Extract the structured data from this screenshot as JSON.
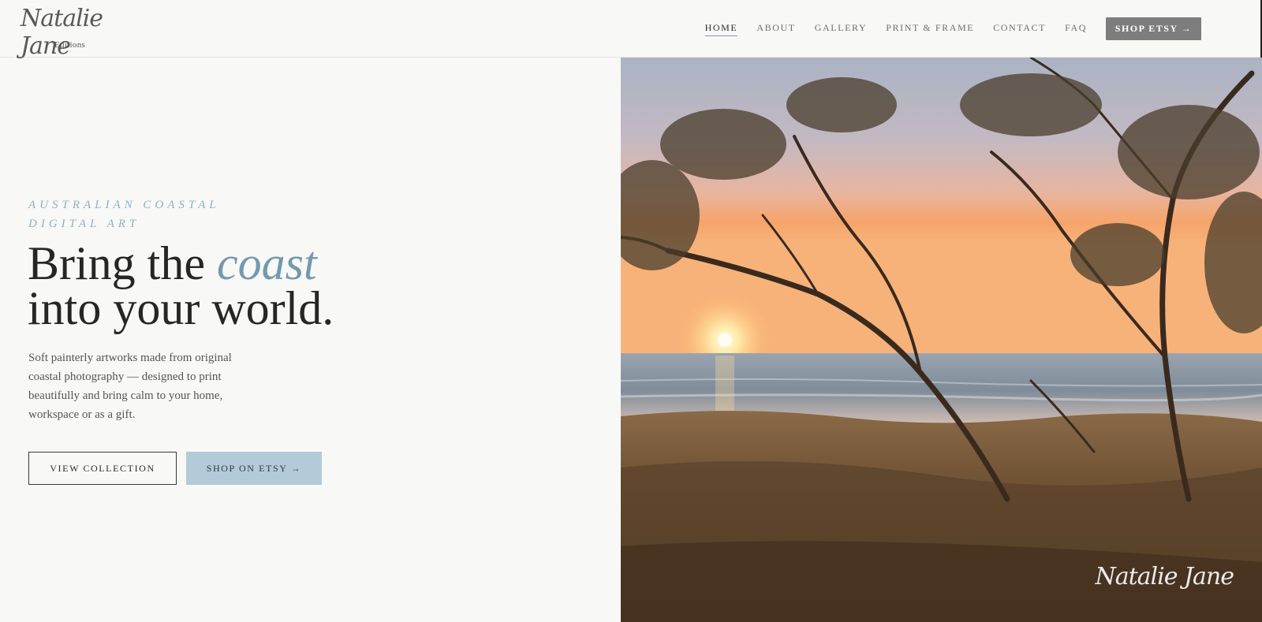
{
  "brand": {
    "script_name": "Natalie Jane",
    "sub_name": "Editions"
  },
  "nav": {
    "items": [
      {
        "label": "HOME",
        "active": true
      },
      {
        "label": "ABOUT",
        "active": false
      },
      {
        "label": "GALLERY",
        "active": false
      },
      {
        "label": "PRINT & FRAME",
        "active": false
      },
      {
        "label": "CONTACT",
        "active": false
      },
      {
        "label": "FAQ",
        "active": false
      }
    ],
    "cta_label": "SHOP ETSY →"
  },
  "hero": {
    "eyebrow": "AUSTRALIAN COASTAL DIGITAL ART",
    "headline_part1": "Bring the ",
    "headline_accent": "coast",
    "headline_part2": "into your world.",
    "lede": "Soft painterly artworks made from original coastal photography — designed to print beautifully and bring calm to your home, workspace or as a gift.",
    "primary_button": "VIEW COLLECTION",
    "secondary_button": "SHOP ON ETSY →",
    "image_signature": "Natalie Jane"
  },
  "colors": {
    "accent": "#7499ad",
    "eyebrow": "#8fb0c3",
    "button_fill": "#b3cad8",
    "nav_cta": "#7d7d7d",
    "background": "#f8f8f6"
  }
}
